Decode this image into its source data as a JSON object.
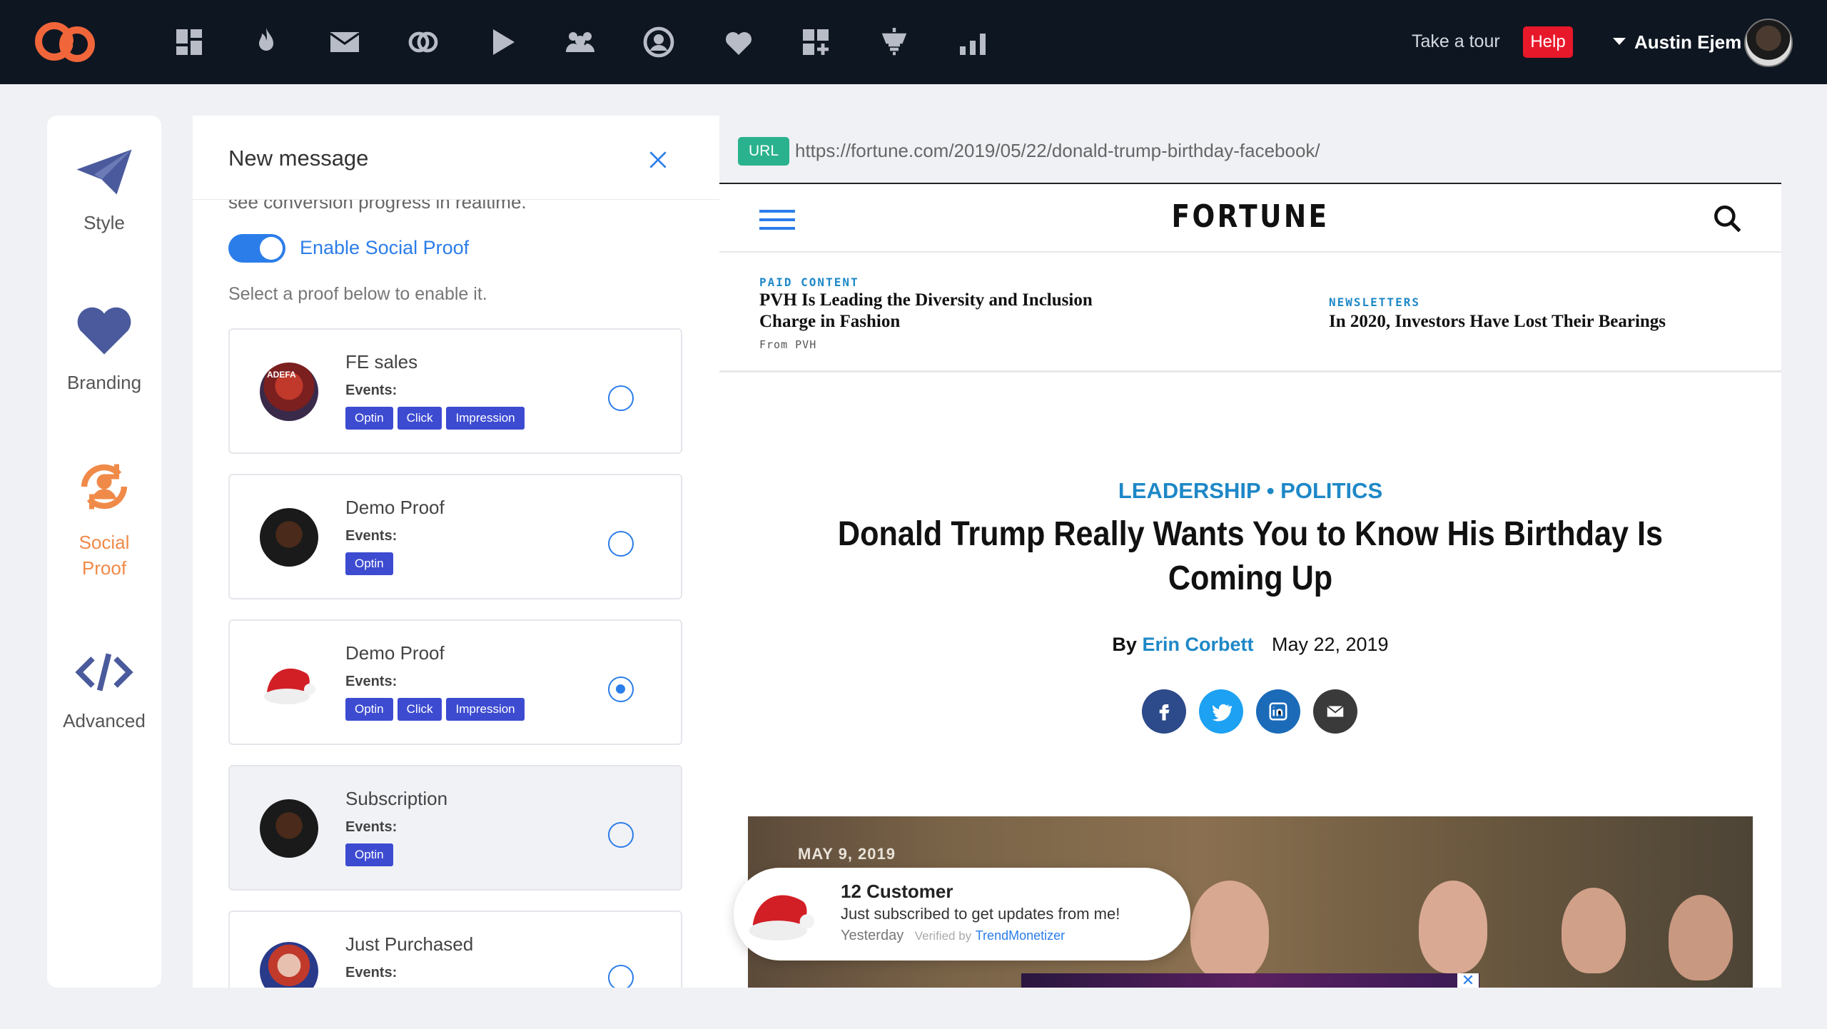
{
  "topbar": {
    "nav_icons": [
      "dashboard-icon",
      "flame-icon",
      "mail-icon",
      "link-icon",
      "play-icon",
      "users-icon",
      "account-circle-icon",
      "heart-icon",
      "add-widget-icon",
      "lamp-icon",
      "bar-chart-icon"
    ],
    "tour_label": "Take a tour",
    "help_label": "Help",
    "user_name": "Austin Ejem"
  },
  "sidebar": {
    "items": [
      {
        "label": "Style",
        "icon": "paper-plane-icon"
      },
      {
        "label": "Branding",
        "icon": "heart-icon"
      },
      {
        "label": "Social Proof",
        "icon": "user-sync-icon",
        "active": true
      },
      {
        "label": "Advanced",
        "icon": "code-icon"
      }
    ]
  },
  "panel": {
    "title": "New message",
    "cut_text": "see conversion progress in realtime.",
    "toggle_label": "Enable Social Proof",
    "toggle_on": true,
    "select_hint": "Select a proof below to enable it.",
    "events_label": "Events:",
    "proofs": [
      {
        "name": "FE sales",
        "events": [
          "Optin",
          "Click",
          "Impression"
        ],
        "selected": false
      },
      {
        "name": "Demo Proof",
        "events": [
          "Optin"
        ],
        "selected": false
      },
      {
        "name": "Demo Proof",
        "events": [
          "Optin",
          "Click",
          "Impression"
        ],
        "selected": true
      },
      {
        "name": "Subscription",
        "events": [
          "Optin"
        ],
        "selected": false
      },
      {
        "name": "Just Purchased",
        "events": [],
        "selected": false
      }
    ]
  },
  "preview": {
    "url_tag": "URL",
    "url": "https://fortune.com/2019/05/22/donald-trump-birthday-facebook/",
    "site_logo": "FORTUNE",
    "promo_left": {
      "kicker": "PAID CONTENT",
      "title_line1": "PVH Is Leading the Diversity and Inclusion",
      "title_line2": "Charge in Fashion",
      "from": "From PVH"
    },
    "promo_right": {
      "kicker": "NEWSLETTERS",
      "title": "In 2020, Investors Have Lost Their Bearings"
    },
    "kicker": "LEADERSHIP • POLITICS",
    "headline": "Donald Trump Really Wants You to Know His Birthday Is Coming Up",
    "byline_by": "By",
    "author": "Erin Corbett",
    "date": "May 22, 2019",
    "share_buttons": [
      "facebook-icon",
      "twitter-icon",
      "linkedin-icon",
      "email-icon"
    ],
    "photo_date": "MAY 9, 2019",
    "ad_close": "✕"
  },
  "notification": {
    "title": "12 Customer",
    "message": "Just subscribed to get updates from me!",
    "time": "Yesterday",
    "verified_by": "Verified by",
    "brand": "TrendMonetizer"
  },
  "colors": {
    "topbar": "#0e1621",
    "accent_blue": "#2b7de9",
    "tag_blue": "#3d4bd1",
    "active_orange": "#f08a49",
    "help_red": "#e8182b",
    "url_green": "#2ab28e",
    "fortune_blue": "#1e88c7"
  }
}
